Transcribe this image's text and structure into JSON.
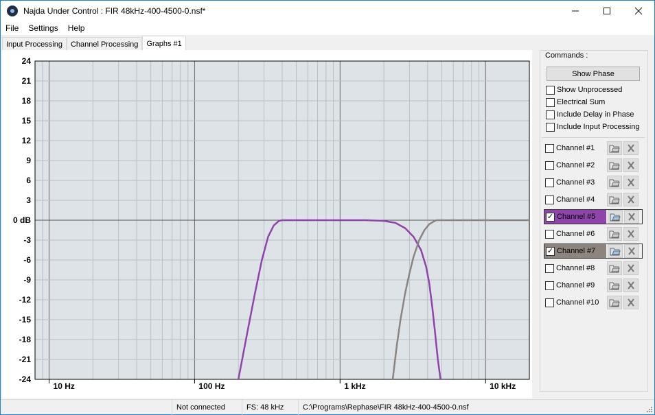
{
  "window": {
    "title": "Najda Under Control : FIR 48kHz-400-4500-0.nsf*"
  },
  "menu": {
    "file": "File",
    "settings": "Settings",
    "help": "Help"
  },
  "tabs": [
    "Input Processing",
    "Channel Processing",
    "Graphs #1"
  ],
  "commands": {
    "label": "Commands :",
    "show_phase": "Show Phase",
    "options": [
      {
        "label": "Show Unprocessed",
        "checked": false
      },
      {
        "label": "Electrical Sum",
        "checked": false
      },
      {
        "label": "Include Delay in Phase",
        "checked": false
      },
      {
        "label": "Include Input Processing",
        "checked": false
      }
    ],
    "channels": [
      {
        "label": "Channel #1",
        "checked": false,
        "color": ""
      },
      {
        "label": "Channel #2",
        "checked": false,
        "color": ""
      },
      {
        "label": "Channel #3",
        "checked": false,
        "color": ""
      },
      {
        "label": "Channel #4",
        "checked": false,
        "color": ""
      },
      {
        "label": "Channel #5",
        "checked": true,
        "color": "#8e44a8"
      },
      {
        "label": "Channel #6",
        "checked": false,
        "color": ""
      },
      {
        "label": "Channel #7",
        "checked": true,
        "color": "#8c857f"
      },
      {
        "label": "Channel #8",
        "checked": false,
        "color": ""
      },
      {
        "label": "Channel #9",
        "checked": false,
        "color": ""
      },
      {
        "label": "Channel #10",
        "checked": false,
        "color": ""
      }
    ]
  },
  "status": {
    "connection": "Not connected",
    "fs": "FS: 48 kHz",
    "path": "C:\\Programs\\Rephase\\FIR 48kHz-400-4500-0.nsf"
  },
  "chart_data": {
    "type": "line",
    "xscale": "log",
    "xlim": [
      8,
      20000
    ],
    "ylim": [
      -24,
      24
    ],
    "yticks": [
      "24",
      "21",
      "18",
      "15",
      "12",
      "9",
      "6",
      "3",
      "0 dB",
      "-3",
      "-6",
      "-9",
      "-12",
      "-15",
      "-18",
      "-21",
      "-24"
    ],
    "xticks": [
      {
        "value": 10,
        "label": "10 Hz"
      },
      {
        "value": 100,
        "label": "100 Hz"
      },
      {
        "value": 1000,
        "label": "1 kHz"
      },
      {
        "value": 10000,
        "label": "10 kHz"
      }
    ],
    "plot_bg": "#dde3e6",
    "series": [
      {
        "name": "Channel #5",
        "color": "#8e44a8",
        "x": [
          200,
          230,
          260,
          290,
          320,
          350,
          380,
          400,
          450,
          600,
          1000,
          1500,
          2000,
          2400,
          2800,
          3200,
          3600,
          3900,
          4100,
          4300,
          4500,
          4700,
          4900
        ],
        "y": [
          -24,
          -17,
          -11,
          -6,
          -2.5,
          -0.8,
          -0.1,
          0,
          0,
          0,
          0,
          0,
          -0.1,
          -0.4,
          -1.2,
          -2.5,
          -4.5,
          -7,
          -9.5,
          -13,
          -17,
          -21,
          -24
        ]
      },
      {
        "name": "Channel #7",
        "color": "#8c857f",
        "x": [
          2300,
          2450,
          2600,
          2800,
          3000,
          3200,
          3500,
          3800,
          4100,
          4400,
          4600,
          5000,
          7000,
          10000,
          15000,
          20000
        ],
        "y": [
          -24,
          -19,
          -15,
          -11,
          -8,
          -5.5,
          -3,
          -1.5,
          -0.6,
          -0.2,
          0,
          0,
          0,
          0,
          0,
          0
        ]
      }
    ]
  }
}
